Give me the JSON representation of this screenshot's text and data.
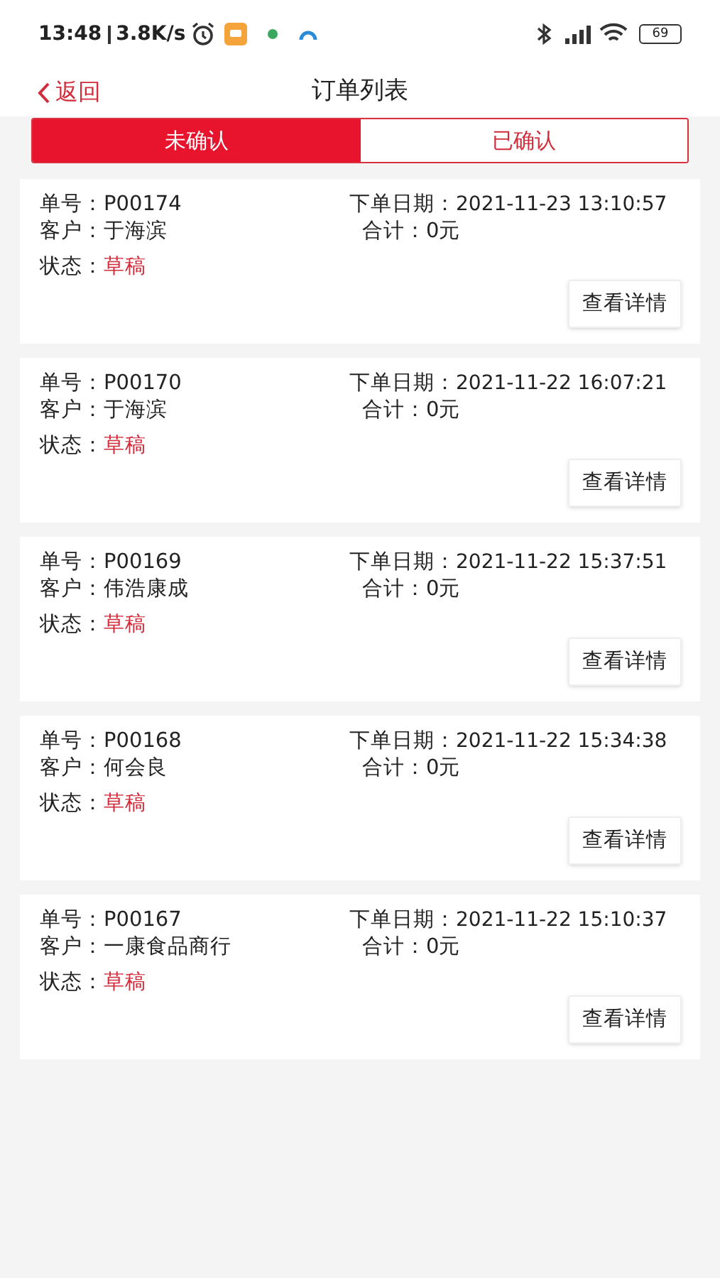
{
  "status_bar": {
    "time": "13:48",
    "speed": "3.8K/s",
    "battery": "69"
  },
  "nav": {
    "back": "返回",
    "title": "订单列表"
  },
  "tabs": [
    {
      "label": "未确认",
      "selected": true
    },
    {
      "label": "已确认",
      "selected": false
    }
  ],
  "orders": [
    {
      "number_label": "单号：",
      "number": "P00174",
      "date_label": "下单日期：",
      "date": "2021-11-23 13:10:57",
      "customer_label": "客户：",
      "customer": "于海滨",
      "total_label": "合计：",
      "total": "0元",
      "status_label": "状态：",
      "status": "草稿",
      "button": "查看详情"
    },
    {
      "number_label": "单号：",
      "number": "P00170",
      "date_label": "下单日期：",
      "date": "2021-11-22 16:07:21",
      "customer_label": "客户：",
      "customer": "于海滨",
      "total_label": "合计：",
      "total": "0元",
      "status_label": "状态：",
      "status": "草稿",
      "button": "查看详情"
    },
    {
      "number_label": "单号：",
      "number": "P00169",
      "date_label": "下单日期：",
      "date": "2021-11-22 15:37:51",
      "customer_label": "客户：",
      "customer": "伟浩康成",
      "total_label": "合计：",
      "total": "0元",
      "status_label": "状态：",
      "status": "草稿",
      "button": "查看详情"
    },
    {
      "number_label": "单号：",
      "number": "P00168",
      "date_label": "下单日期：",
      "date": "2021-11-22 15:34:38",
      "customer_label": "客户：",
      "customer": "何会良",
      "total_label": "合计：",
      "total": "0元",
      "status_label": "状态：",
      "status": "草稿",
      "button": "查看详情"
    },
    {
      "number_label": "单号：",
      "number": "P00167",
      "date_label": "下单日期：",
      "date": "2021-11-22 15:10:37",
      "customer_label": "客户：",
      "customer": "一康食品商行",
      "total_label": "合计：",
      "total": "0元",
      "status_label": "状态：",
      "status": "草稿",
      "button": "查看详情"
    }
  ]
}
